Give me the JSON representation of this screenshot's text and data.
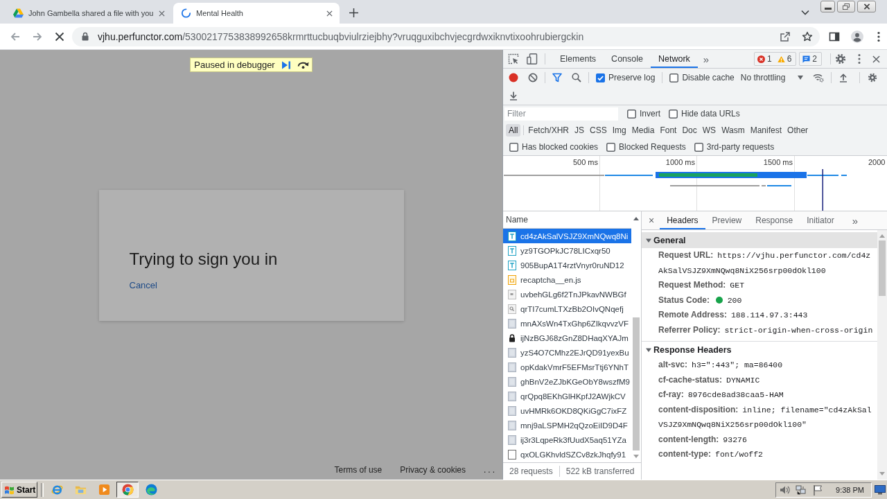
{
  "browser": {
    "tabs": [
      {
        "title": "John Gambella shared a file with you",
        "kind": "drive",
        "selected": false
      },
      {
        "title": "Mental Health",
        "kind": "loading",
        "selected": true
      }
    ],
    "address": {
      "host": "vjhu.perfunctor.com",
      "path": "/5300217753838992658krmrttucbuqbviulrziejbhy?vruqguxibchvjecgrdwxiknvtixoohrubiergckin"
    }
  },
  "page": {
    "debugger_banner": "Paused in debugger",
    "dialog": {
      "title": "Trying to sign you in",
      "link": "Cancel"
    },
    "footer_links": [
      "Terms of use",
      "Privacy & cookies",
      "..."
    ]
  },
  "devtools": {
    "tabs": [
      {
        "label": "Elements",
        "selected": false
      },
      {
        "label": "Console",
        "selected": false
      },
      {
        "label": "Network",
        "selected": true
      }
    ],
    "tabs_more": "»",
    "errors": "1",
    "warnings": "6",
    "messages": "2",
    "preserve_log": {
      "label": "Preserve log",
      "checked": true
    },
    "disable_cache": {
      "label": "Disable cache",
      "checked": false
    },
    "throttling": "No throttling",
    "filter": {
      "placeholder": "Filter"
    },
    "filter_options": [
      {
        "label": "Invert",
        "checked": false
      },
      {
        "label": "Hide data URLs",
        "checked": false
      }
    ],
    "types": [
      {
        "label": "All",
        "selected": true
      },
      {
        "label": "Fetch/XHR",
        "selected": false
      },
      {
        "label": "JS",
        "selected": false
      },
      {
        "label": "CSS",
        "selected": false
      },
      {
        "label": "Img",
        "selected": false
      },
      {
        "label": "Media",
        "selected": false
      },
      {
        "label": "Font",
        "selected": false
      },
      {
        "label": "Doc",
        "selected": false
      },
      {
        "label": "WS",
        "selected": false
      },
      {
        "label": "Wasm",
        "selected": false
      },
      {
        "label": "Manifest",
        "selected": false
      },
      {
        "label": "Other",
        "selected": false
      }
    ],
    "blocked_options": [
      {
        "label": "Has blocked cookies",
        "checked": false
      },
      {
        "label": "Blocked Requests",
        "checked": false
      },
      {
        "label": "3rd-party requests",
        "checked": false
      }
    ],
    "overview": {
      "ticks": [
        "500 ms",
        "1000 ms",
        "1500 ms",
        "2000"
      ]
    },
    "requests": {
      "column": "Name",
      "rows": [
        {
          "name": "cd4zAkSalVSJZ9XmNQwq8Ni",
          "kind": "font",
          "selected": true
        },
        {
          "name": "yz9TGOPkJC78LICxqr50",
          "kind": "font",
          "selected": false
        },
        {
          "name": "905BupA1T4rztVnyr0ruND12",
          "kind": "font",
          "selected": false
        },
        {
          "name": "recaptcha__en.js",
          "kind": "script",
          "selected": false
        },
        {
          "name": "uvbehGLg6f2TnJPkavNWBGf",
          "kind": "other",
          "selected": false
        },
        {
          "name": "qrTI7cumLTXzBb2OIvQNqefj",
          "kind": "search",
          "selected": false
        },
        {
          "name": "mnAXsWn4TxGhp6ZIkqvvzVF",
          "kind": "image",
          "selected": false
        },
        {
          "name": "ijNzBGJ68zGnZ8DHaqXYAJm",
          "kind": "lock",
          "selected": false
        },
        {
          "name": "yzS4O7CMhz2EJrQD91yexBu",
          "kind": "image",
          "selected": false
        },
        {
          "name": "opKdakVmrF5EFMsrTtj6YNhT",
          "kind": "image",
          "selected": false
        },
        {
          "name": "ghBnV2eZJbKGeObY8wszfM9",
          "kind": "image",
          "selected": false
        },
        {
          "name": "qrQpq8EKhGlHKpfJ2AWjkCV",
          "kind": "image",
          "selected": false
        },
        {
          "name": "uvHMRk6OKD8QKiGgC7ixFZ",
          "kind": "image",
          "selected": false
        },
        {
          "name": "mnj9aLSPMH2qQzoEiID9D4F",
          "kind": "image",
          "selected": false
        },
        {
          "name": "ij3r3LqpeRk3fUudX5aq51YZa",
          "kind": "image",
          "selected": false
        },
        {
          "name": "qxOLGKhvldSZCv8zkJhqfy91",
          "kind": "document",
          "selected": false
        }
      ],
      "summary": [
        "28 requests",
        "522 kB transferred"
      ]
    },
    "details": {
      "close": "×",
      "tabs": [
        {
          "label": "Headers",
          "selected": true
        },
        {
          "label": "Preview",
          "selected": false
        },
        {
          "label": "Response",
          "selected": false
        },
        {
          "label": "Initiator",
          "selected": false
        }
      ],
      "tabs_more": "»",
      "sections": [
        {
          "title": "General",
          "expanded": true,
          "selected": true,
          "rows": [
            {
              "name": "Request URL:",
              "value": "https://vjhu.perfunctor.com/cd4zAkSalVSJZ9XmNQwq8NiX256srp00dOkl100",
              "kind": "text"
            },
            {
              "name": "Request Method:",
              "value": "GET",
              "kind": "text"
            },
            {
              "name": "Status Code:",
              "value": "200",
              "kind": "status"
            },
            {
              "name": "Remote Address:",
              "value": "188.114.97.3:443",
              "kind": "text"
            },
            {
              "name": "Referrer Policy:",
              "value": "strict-origin-when-cross-origin",
              "kind": "text"
            }
          ]
        },
        {
          "title": "Response Headers",
          "expanded": true,
          "selected": false,
          "rows": [
            {
              "name": "alt-svc:",
              "value": "h3=\":443\"; ma=86400",
              "kind": "text"
            },
            {
              "name": "cf-cache-status:",
              "value": "DYNAMIC",
              "kind": "text"
            },
            {
              "name": "cf-ray:",
              "value": "8976cde8ad38caa5-HAM",
              "kind": "text"
            },
            {
              "name": "content-disposition:",
              "value": "inline; filename=\"cd4zAkSalVSJZ9XmNQwq8NiX256srp00dOkl100\"",
              "kind": "text"
            },
            {
              "name": "content-length:",
              "value": "93276",
              "kind": "text"
            },
            {
              "name": "content-type:",
              "value": "font/woff2",
              "kind": "text"
            }
          ]
        }
      ]
    }
  },
  "taskbar": {
    "start": "Start",
    "apps": [
      {
        "kind": "ie",
        "selected": false
      },
      {
        "kind": "folder",
        "selected": false
      },
      {
        "kind": "media",
        "selected": false
      },
      {
        "kind": "chrome",
        "selected": true
      },
      {
        "kind": "edge",
        "selected": false
      }
    ],
    "clock": "9:38 PM"
  }
}
